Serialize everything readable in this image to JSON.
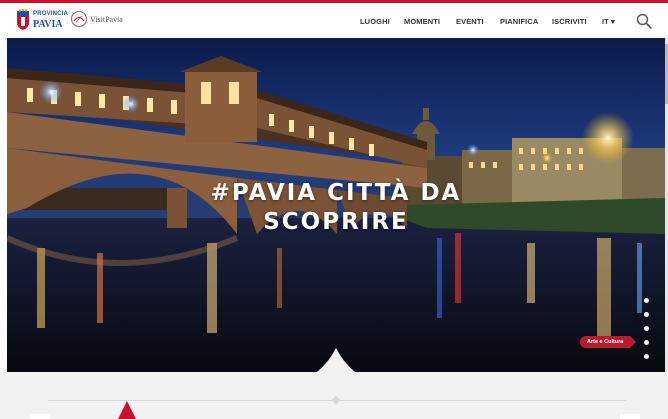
{
  "header": {
    "province_logo": {
      "line1": "PROVINCIA",
      "line2": "PAVIA"
    },
    "visit_logo": {
      "text": "VisitPavia"
    },
    "nav": [
      {
        "label": "LUOGHI"
      },
      {
        "label": "MOMENTI"
      },
      {
        "label": "EVENTI"
      },
      {
        "label": "PIANIFICA"
      },
      {
        "label": "ISCRIVITI"
      },
      {
        "label": "IT ▾"
      }
    ],
    "search_icon": "search-icon"
  },
  "hero": {
    "title_line1": "#PAVIA CITTÀ DA",
    "title_line2": "SCOPRIRE",
    "category_badge": "Arte e Cultura",
    "slides": 5,
    "active_slide": 4
  },
  "colors": {
    "accent": "#c8102e",
    "badge": "#b71c2a",
    "nav_text": "#333333"
  }
}
